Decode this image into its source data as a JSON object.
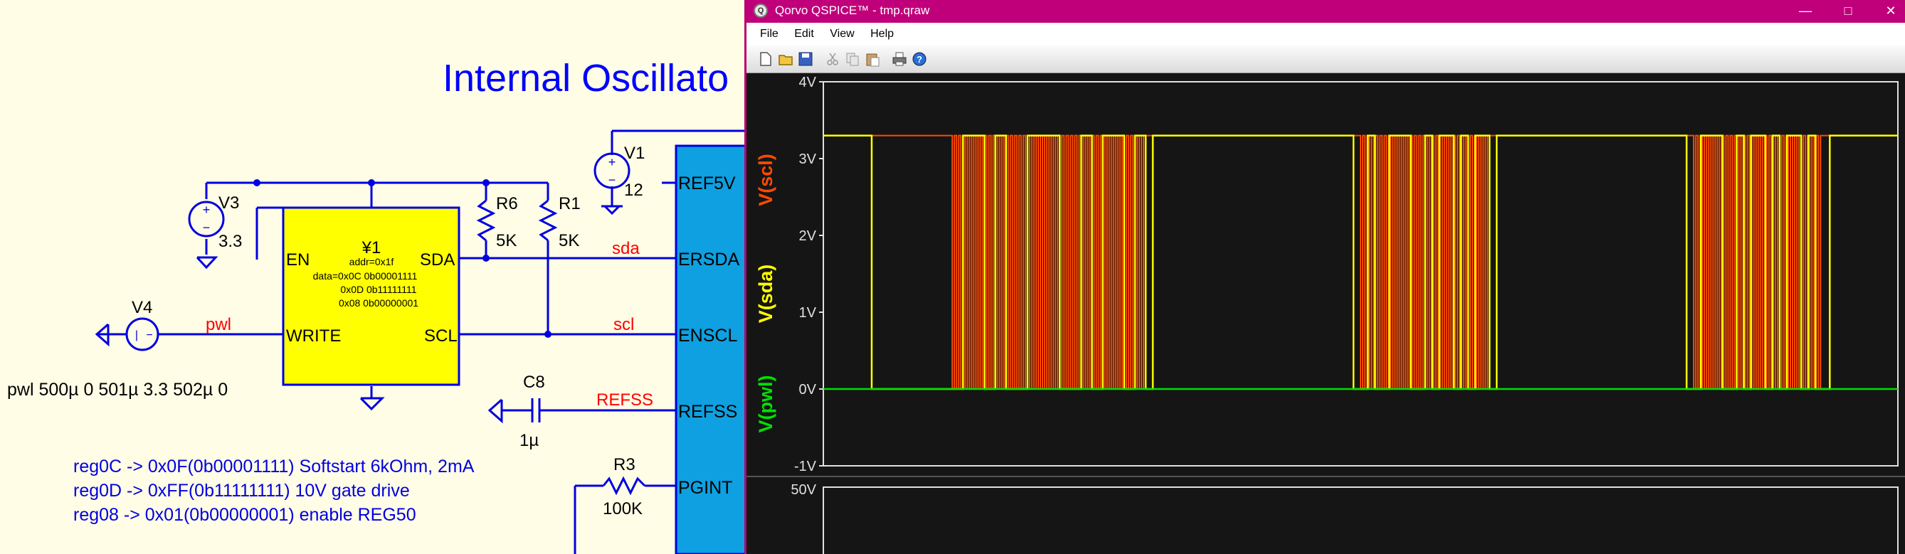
{
  "schematic": {
    "title": "Internal Oscillato",
    "components": {
      "v3": {
        "name": "V3",
        "value": "3.3"
      },
      "v1": {
        "name": "V1",
        "value": "12"
      },
      "v4": {
        "name": "V4"
      },
      "r6": {
        "name": "R6",
        "value": "5K"
      },
      "r1": {
        "name": "R1",
        "value": "5K"
      },
      "r3": {
        "name": "R3",
        "value": "100K"
      },
      "c8": {
        "name": "C8",
        "value": "1µ"
      },
      "u1": {
        "name": "¥1",
        "addr": "addr=0x1f",
        "data": [
          "data=0x0C 0b00001111",
          "0x0D 0b11111111",
          "0x08 0b00000001"
        ],
        "pins": {
          "en": "EN",
          "sda": "SDA",
          "write": "WRITE",
          "scl": "SCL"
        }
      }
    },
    "nets": {
      "sda": "sda",
      "scl": "scl",
      "pwl": "pwl",
      "refss": "REFSS"
    },
    "ic_pins": [
      "REF5V",
      "ERSDA",
      "ENSCL",
      "REFSS",
      "PGINT"
    ],
    "pwl_directive": "pwl 500µ 0 501µ 3.3 502µ 0",
    "comments": [
      "reg0C -> 0x0F(0b00001111) Softstart 6kOhm, 2mA",
      "reg0D -> 0xFF(0b11111111) 10V gate drive",
      "reg08 -> 0x01(0b00000001) enable REG50"
    ]
  },
  "window": {
    "title": "Qorvo QSPICE™ - tmp.qraw",
    "icon": "qspice-app-icon",
    "controls": [
      "minimize-icon",
      "maximize-icon",
      "close-icon"
    ],
    "menu": [
      "File",
      "Edit",
      "View",
      "Help"
    ],
    "toolbar_icons": [
      "new-icon",
      "open-icon",
      "save-icon",
      "cut-icon",
      "copy-icon",
      "paste-icon",
      "print-icon",
      "help-icon"
    ]
  },
  "plot": {
    "traces": [
      {
        "label": "V(scl)",
        "color": "#ff4a00"
      },
      {
        "label": "V(sda)",
        "color": "#ffff00"
      },
      {
        "label": "V(pwl)",
        "color": "#00e000"
      }
    ],
    "y_ticks": [
      "4V",
      "3V",
      "2V",
      "1V",
      "0V",
      "-1V"
    ],
    "lower_y_tick": "50V",
    "grid": false
  },
  "chart_data": {
    "type": "line",
    "ylim": [
      -1,
      4
    ],
    "series": [
      {
        "name": "V(scl)",
        "high": 3.3,
        "low": 0,
        "bursts": [
          [
            0.12,
            0.3
          ],
          [
            0.5,
            0.62
          ],
          [
            0.81,
            0.93
          ]
        ],
        "description_only": "clock toggling"
      },
      {
        "name": "V(sda)",
        "high": 3.3,
        "low": 0
      },
      {
        "name": "V(pwl)",
        "values": [
          0,
          0
        ]
      }
    ]
  }
}
